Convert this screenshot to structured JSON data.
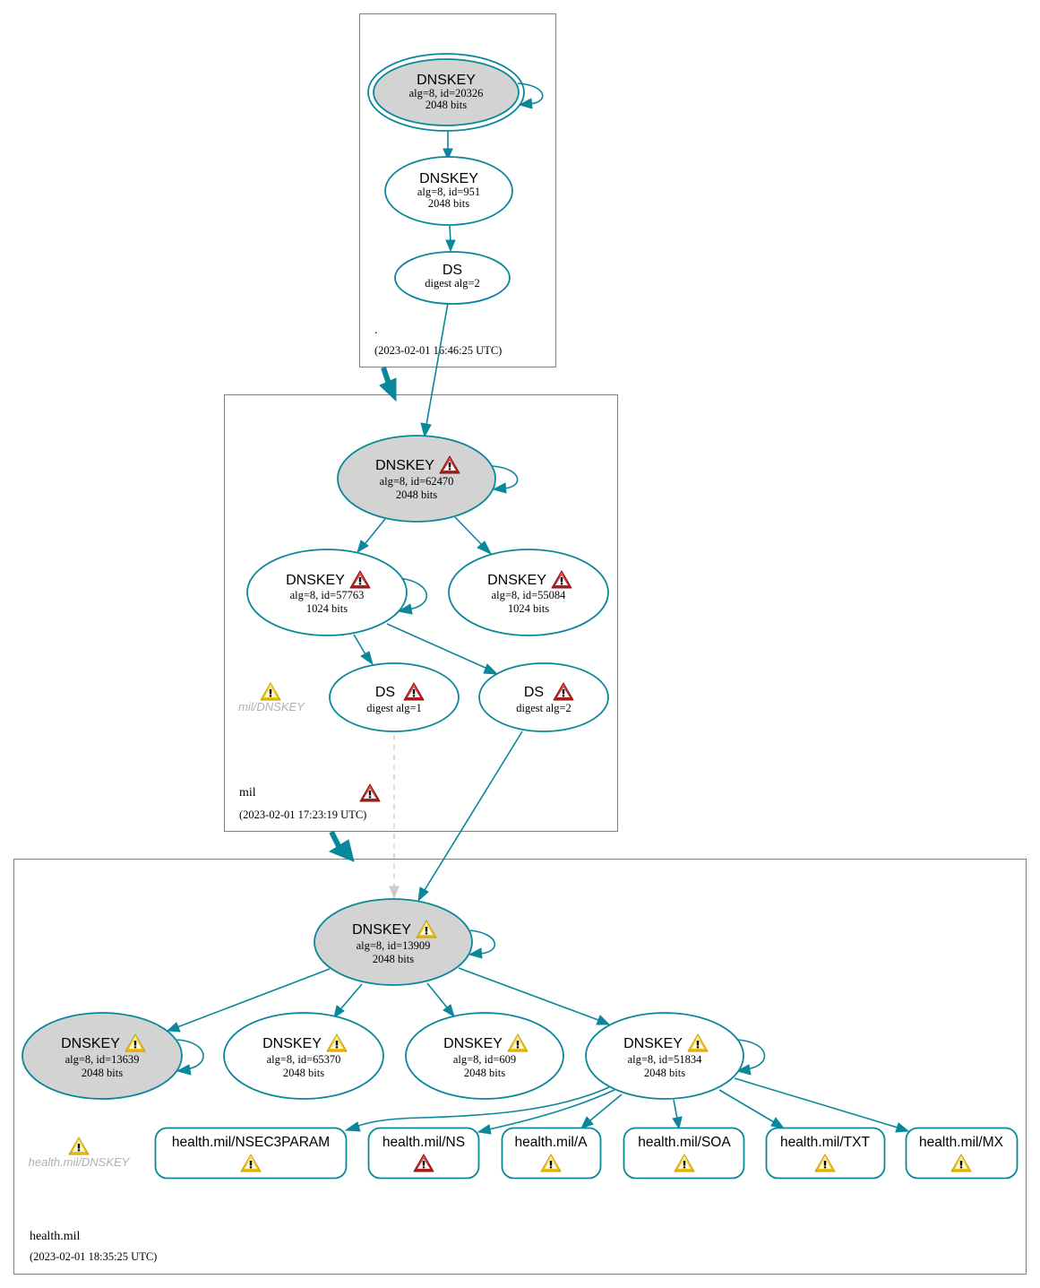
{
  "colors": {
    "edge": "#0a879a",
    "ksk_fill": "#d3d3d3",
    "node_fill": "#ffffff",
    "zone_border": "#7f7f7f",
    "warning_yellow": "#f5d000",
    "error_red": "#c8242b",
    "insecure_edge": "#cccccc"
  },
  "zones": [
    {
      "name": ".",
      "timestamp": "(2023-02-01 16:46:25 UTC)",
      "status_icon": null,
      "nodes": [
        {
          "id": "root-ksk",
          "type": "DNSKEY",
          "label": "DNSKEY",
          "line1": "alg=8, id=20326",
          "line2": "2048 bits",
          "ksk": true,
          "trust_anchor": true,
          "status": null
        },
        {
          "id": "root-zsk",
          "type": "DNSKEY",
          "label": "DNSKEY",
          "line1": "alg=8, id=951",
          "line2": "2048 bits",
          "ksk": false,
          "status": null
        },
        {
          "id": "root-ds",
          "type": "DS",
          "label": "DS",
          "line1": "digest alg=2",
          "status": null
        }
      ]
    },
    {
      "name": "mil",
      "timestamp": "(2023-02-01 17:23:19 UTC)",
      "status_icon": "error",
      "nodes": [
        {
          "id": "mil-ksk",
          "type": "DNSKEY",
          "label": "DNSKEY",
          "line1": "alg=8, id=62470",
          "line2": "2048 bits",
          "ksk": true,
          "status": "error"
        },
        {
          "id": "mil-zsk1",
          "type": "DNSKEY",
          "label": "DNSKEY",
          "line1": "alg=8, id=57763",
          "line2": "1024 bits",
          "ksk": false,
          "status": "error"
        },
        {
          "id": "mil-zsk2",
          "type": "DNSKEY",
          "label": "DNSKEY",
          "line1": "alg=8, id=55084",
          "line2": "1024 bits",
          "ksk": false,
          "status": "error"
        },
        {
          "id": "mil-ds1",
          "type": "DS",
          "label": "DS",
          "line1": "digest alg=1",
          "status": "error"
        },
        {
          "id": "mil-ds2",
          "type": "DS",
          "label": "DS",
          "line1": "digest alg=2",
          "status": "error"
        }
      ],
      "rrset_warning": {
        "label": "mil/DNSKEY",
        "status": "warning"
      }
    },
    {
      "name": "health.mil",
      "timestamp": "(2023-02-01 18:35:25 UTC)",
      "status_icon": null,
      "nodes": [
        {
          "id": "hm-ksk",
          "type": "DNSKEY",
          "label": "DNSKEY",
          "line1": "alg=8, id=13909",
          "line2": "2048 bits",
          "ksk": true,
          "status": "warning"
        },
        {
          "id": "hm-k1",
          "type": "DNSKEY",
          "label": "DNSKEY",
          "line1": "alg=8, id=13639",
          "line2": "2048 bits",
          "ksk": true,
          "status": "warning"
        },
        {
          "id": "hm-k2",
          "type": "DNSKEY",
          "label": "DNSKEY",
          "line1": "alg=8, id=65370",
          "line2": "2048 bits",
          "ksk": false,
          "status": "warning"
        },
        {
          "id": "hm-k3",
          "type": "DNSKEY",
          "label": "DNSKEY",
          "line1": "alg=8, id=609",
          "line2": "2048 bits",
          "ksk": false,
          "status": "warning"
        },
        {
          "id": "hm-k4",
          "type": "DNSKEY",
          "label": "DNSKEY",
          "line1": "alg=8, id=51834",
          "line2": "2048 bits",
          "ksk": false,
          "status": "warning"
        }
      ],
      "rrsets": [
        {
          "label": "health.mil/NSEC3PARAM",
          "status": "warning"
        },
        {
          "label": "health.mil/NS",
          "status": "error"
        },
        {
          "label": "health.mil/A",
          "status": "warning"
        },
        {
          "label": "health.mil/SOA",
          "status": "warning"
        },
        {
          "label": "health.mil/TXT",
          "status": "warning"
        },
        {
          "label": "health.mil/MX",
          "status": "warning"
        }
      ],
      "rrset_warning": {
        "label": "health.mil/DNSKEY",
        "status": "warning"
      }
    }
  ]
}
